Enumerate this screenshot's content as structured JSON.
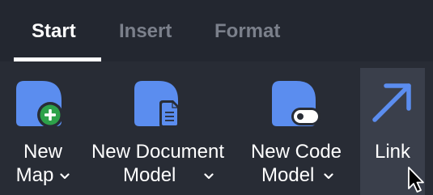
{
  "tabs": [
    {
      "label": "Start",
      "active": true
    },
    {
      "label": "Insert",
      "active": false
    },
    {
      "label": "Format",
      "active": false
    }
  ],
  "ribbon": {
    "new_map": {
      "line1": "New",
      "line2": "Map"
    },
    "new_document_model": {
      "line1": "New Document",
      "line2": "Model"
    },
    "new_code_model": {
      "line1": "New Code",
      "line2": "Model"
    },
    "link": {
      "line1": "Link"
    }
  },
  "colors": {
    "background": "#282c35",
    "tab_bar": "#232730",
    "accent_blue": "#5b8def",
    "add_green": "#2ea24a",
    "inactive_tab": "#7b808b",
    "hover_bg": "#3a3f4b"
  },
  "icons": {
    "new_map": "map-add-icon",
    "new_document_model": "document-icon",
    "new_code_model": "code-toggle-icon",
    "link": "arrow-up-right-icon",
    "dropdown": "chevron-down-icon"
  }
}
